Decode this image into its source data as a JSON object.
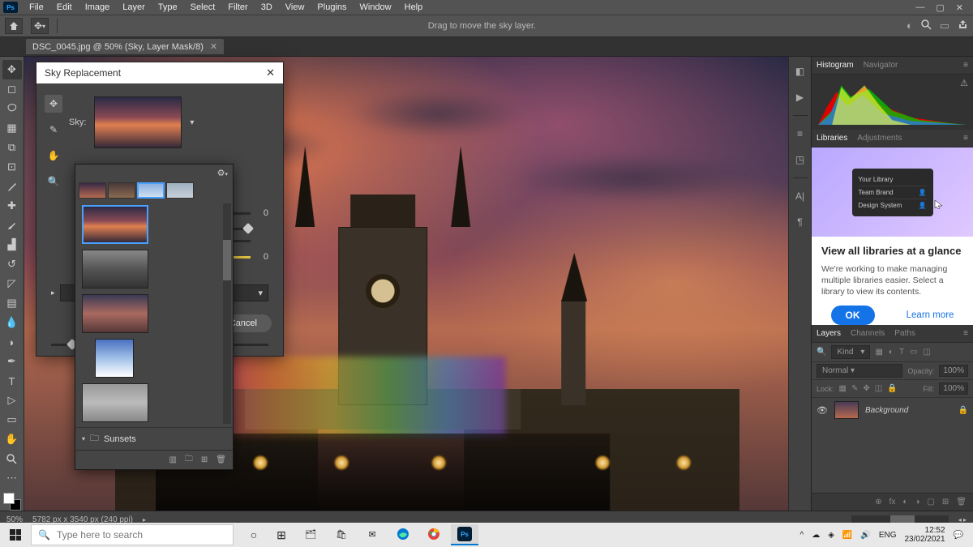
{
  "menubar": [
    "File",
    "Edit",
    "Image",
    "Layer",
    "Type",
    "Select",
    "Filter",
    "3D",
    "View",
    "Plugins",
    "Window",
    "Help"
  ],
  "optionsbar": {
    "hint": "Drag to move the sky layer."
  },
  "doctab": {
    "title": "DSC_0045.jpg @ 50% (Sky, Layer Mask/8)"
  },
  "status": {
    "zoom": "50%",
    "dims": "5782 px x 3540 px (240 ppi)"
  },
  "dialog": {
    "title": "Sky Replacement",
    "sky_label": "Sky:",
    "sliders": [
      {
        "val": "0",
        "pos": 50
      },
      {
        "val": "",
        "pos": 96
      },
      {
        "val": "",
        "pos": 30
      },
      {
        "val": "0",
        "pos": 50
      }
    ],
    "cancel": "Cancel",
    "preset_folder": "Sunsets"
  },
  "panels": {
    "histogram_tabs": [
      "Histogram",
      "Navigator"
    ],
    "lib_tabs": [
      "Libraries",
      "Adjustments"
    ],
    "lib_promo": {
      "card": [
        "Your Library",
        "Team Brand",
        "Design System"
      ],
      "title": "View all libraries at a glance",
      "text": "We're working to make managing multiple libraries easier. Select a library to view its contents.",
      "ok": "OK",
      "learn": "Learn more"
    },
    "layers_tabs": [
      "Layers",
      "Channels",
      "Paths"
    ],
    "layers": {
      "kind": "Kind",
      "blend": "Normal",
      "opacity_label": "Opacity:",
      "opacity_val": "100%",
      "lock_label": "Lock:",
      "fill_label": "Fill:",
      "fill_val": "100%",
      "bg_layer": "Background"
    }
  },
  "taskbar": {
    "search_placeholder": "Type here to search",
    "lang": "ENG",
    "time": "12:52",
    "date": "23/02/2021"
  }
}
